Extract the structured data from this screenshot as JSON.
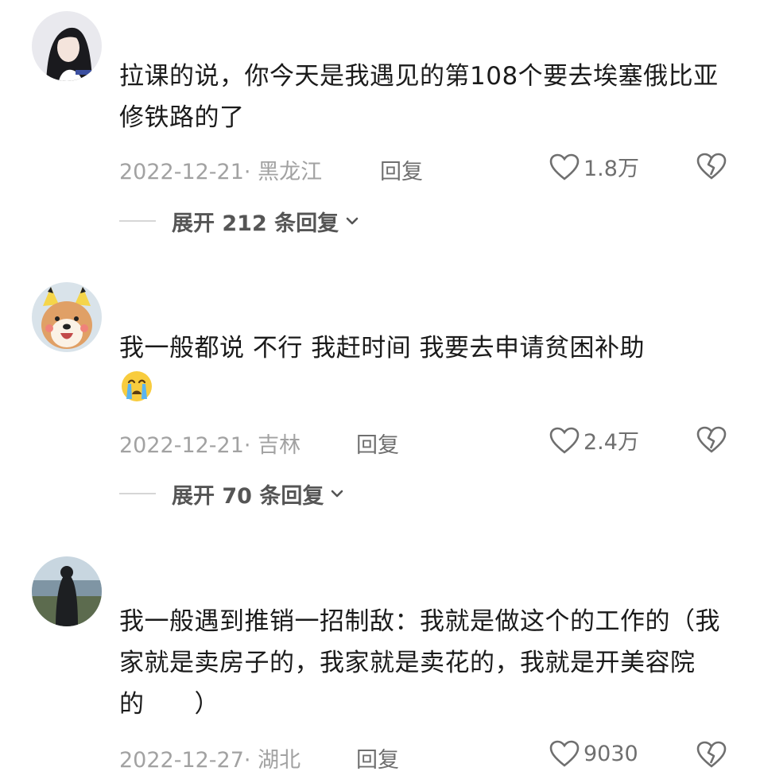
{
  "comments": [
    {
      "text": "拉课的说，你今天是我遇见的第108个要去埃塞俄比亚修铁路的了",
      "date_loc": "2022-12-21· 黑龙江",
      "reply": "回复",
      "likes": "1.8万",
      "expand": "展开 212 条回复"
    },
    {
      "text": "我一般都说 不行 我赶时间 我要去申请贫困补助",
      "date_loc": "2022-12-21· 吉林",
      "reply": "回复",
      "likes": "2.4万",
      "expand": "展开 70 条回复"
    },
    {
      "text": "我一般遇到推销一招制敌：我就是做这个的工作的（我家就是卖房子的，我家就是卖花的，我就是开美容院的　　）",
      "date_loc": "2022-12-27· 湖北",
      "reply": "回复",
      "likes": "9030"
    }
  ],
  "icons": {
    "like": "heart-outline-icon",
    "dislike": "broken-heart-icon",
    "expand": "chevron-down-icon",
    "emoji": "crying-face-emoji"
  },
  "colors": {
    "text": "#1b1b1b",
    "meta": "#a2a2a2",
    "action": "#6f6f6f",
    "expand": "#555555"
  }
}
